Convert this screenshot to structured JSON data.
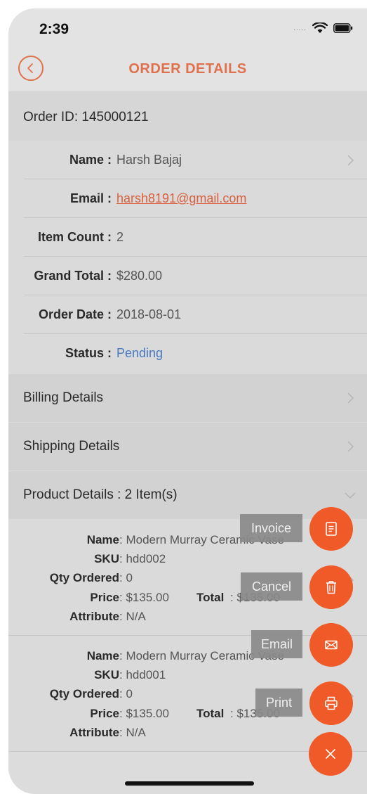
{
  "status_bar": {
    "time": "2:39",
    "signal_dots": "....."
  },
  "nav": {
    "title": "ORDER DETAILS"
  },
  "order": {
    "id_text": "Order ID: 145000121"
  },
  "info": {
    "name_label": "Name :",
    "name_value": "Harsh Bajaj",
    "email_label": "Email :",
    "email_value": "harsh8191@gmail.com",
    "item_count_label": "Item Count :",
    "item_count_value": "2",
    "grand_total_label": "Grand Total :",
    "grand_total_value": "$280.00",
    "order_date_label": "Order Date :",
    "order_date_value": "2018-08-01",
    "status_label": "Status :",
    "status_value": "Pending"
  },
  "sections": {
    "billing": "Billing Details",
    "shipping": "Shipping Details",
    "products": "Product Details : 2 Item(s)"
  },
  "products": [
    {
      "name_label": "Name",
      "name": "Modern Murray Ceramic Vase",
      "sku_label": "SKU",
      "sku": "hdd002",
      "qty_label": "Qty Ordered",
      "qty": "0",
      "price_label": "Price",
      "price": "$135.00",
      "total_label": "Total",
      "total": "$135.00",
      "attr_label": "Attribute",
      "attr": "N/A"
    },
    {
      "name_label": "Name",
      "name": "Modern Murray Ceramic Vase",
      "sku_label": "SKU",
      "sku": "hdd001",
      "qty_label": "Qty Ordered",
      "qty": "0",
      "price_label": "Price",
      "price": "$135.00",
      "total_label": "Total",
      "total": "$135.00",
      "attr_label": "Attribute",
      "attr": "N/A"
    }
  ],
  "fab_menu": {
    "invoice": "Invoice",
    "cancel": "Cancel",
    "email": "Email",
    "print": "Print"
  },
  "colors": {
    "accent": "#e0714d",
    "fab": "#f05a28",
    "link": "#d9603e",
    "pending": "#4a78c0"
  },
  "icons": [
    "back-arrow-icon",
    "wifi-icon",
    "battery-icon",
    "chevron-right-icon",
    "chevron-down-icon",
    "invoice-icon",
    "trash-icon",
    "mail-icon",
    "printer-icon",
    "close-icon"
  ]
}
